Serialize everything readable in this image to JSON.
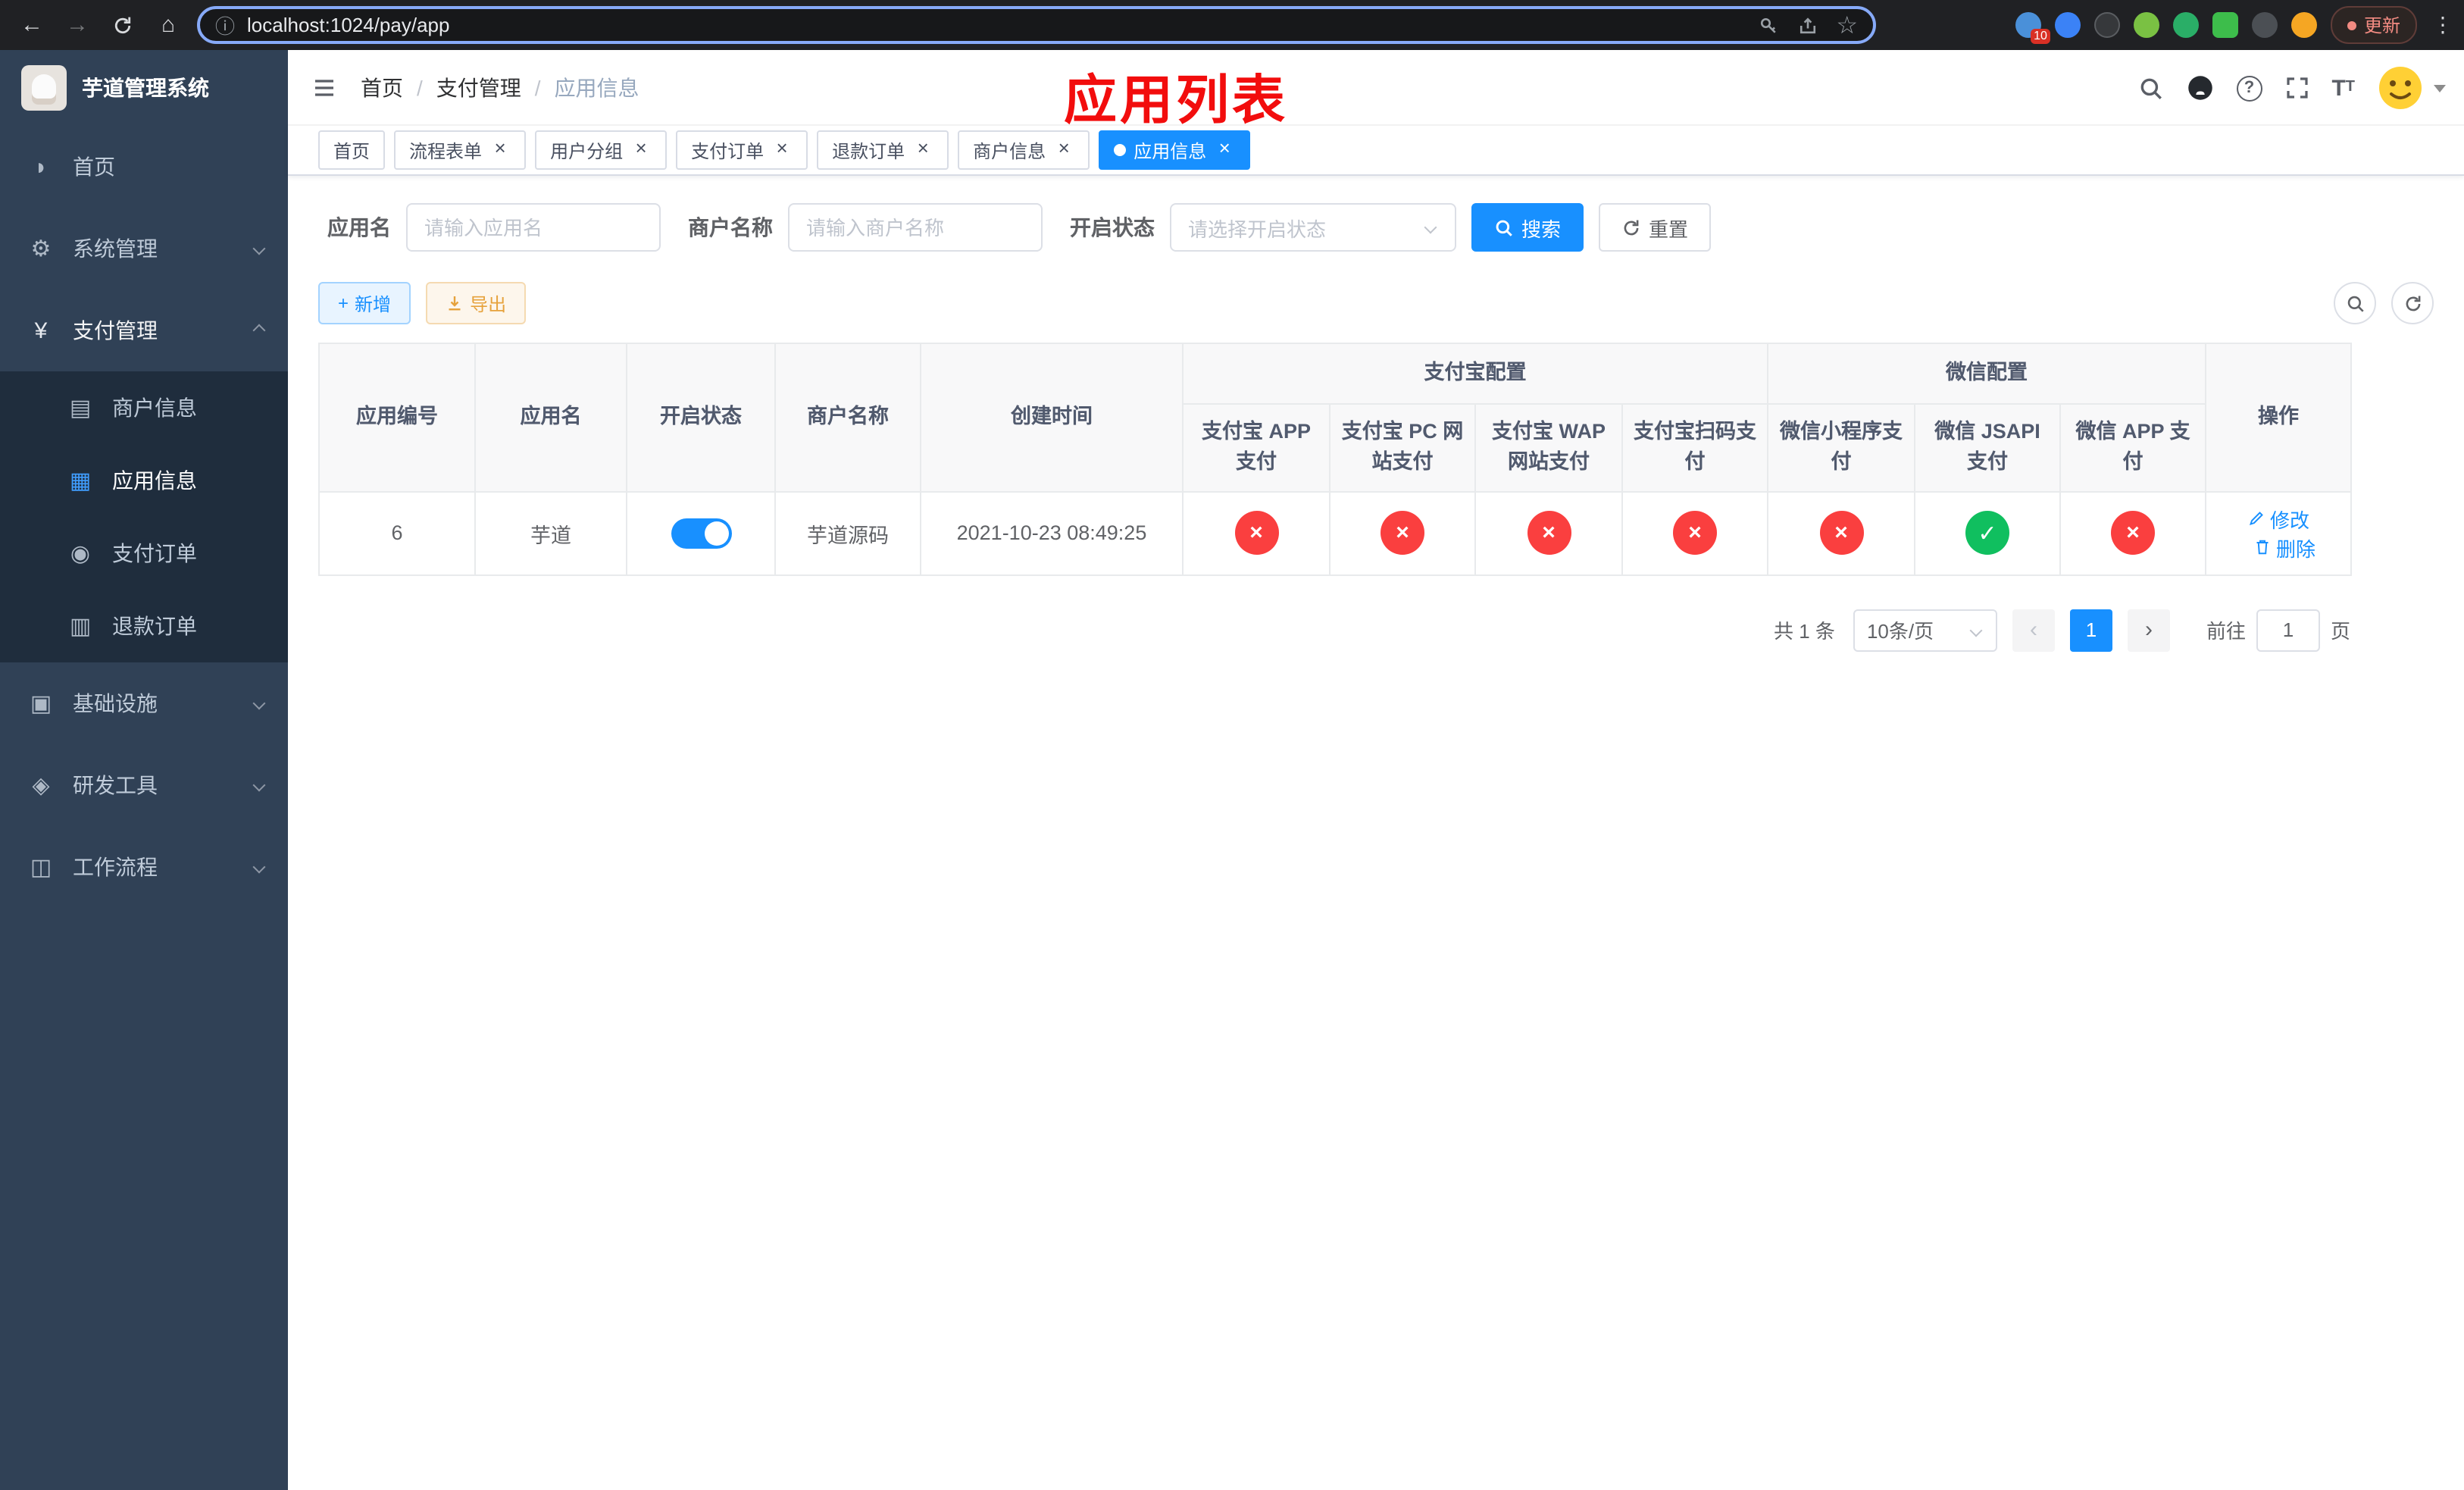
{
  "browser": {
    "url": "localhost:1024/pay/app",
    "update_label": "更新",
    "extension_badge": "10"
  },
  "app_title": "芋道管理系统",
  "sidebar": {
    "items": [
      {
        "label": "首页",
        "icon": "dashboard-icon"
      },
      {
        "label": "系统管理",
        "icon": "gear-icon"
      },
      {
        "label": "支付管理",
        "icon": "yuan-icon"
      },
      {
        "label": "商户信息",
        "icon": "card-icon"
      },
      {
        "label": "应用信息",
        "icon": "grid-icon"
      },
      {
        "label": "支付订单",
        "icon": "order-icon"
      },
      {
        "label": "退款订单",
        "icon": "refund-icon"
      },
      {
        "label": "基础设施",
        "icon": "infra-icon"
      },
      {
        "label": "研发工具",
        "icon": "devtool-icon"
      },
      {
        "label": "工作流程",
        "icon": "workflow-icon"
      }
    ]
  },
  "header": {
    "breadcrumb": {
      "home": "首页",
      "section": "支付管理",
      "page": "应用信息"
    },
    "annotation": "应用列表"
  },
  "tabs": [
    {
      "label": "首页"
    },
    {
      "label": "流程表单"
    },
    {
      "label": "用户分组"
    },
    {
      "label": "支付订单"
    },
    {
      "label": "退款订单"
    },
    {
      "label": "商户信息"
    },
    {
      "label": "应用信息"
    }
  ],
  "filters": {
    "app_name": {
      "label": "应用名",
      "placeholder": "请输入应用名"
    },
    "merchant_name": {
      "label": "商户名称",
      "placeholder": "请输入商户名称"
    },
    "status": {
      "label": "开启状态",
      "placeholder": "请选择开启状态"
    },
    "search_label": "搜索",
    "reset_label": "重置"
  },
  "toolbar": {
    "add_label": "新增",
    "export_label": "导出"
  },
  "table": {
    "headers": {
      "app_id": "应用编号",
      "app_name": "应用名",
      "status": "开启状态",
      "merchant": "商户名称",
      "create_time": "创建时间",
      "alipay_group": "支付宝配置",
      "wechat_group": "微信配置",
      "alipay_app": "支付宝 APP 支付",
      "alipay_pc": "支付宝 PC 网站支付",
      "alipay_wap": "支付宝 WAP 网站支付",
      "alipay_scan": "支付宝扫码支付",
      "wechat_mini": "微信小程序支付",
      "wechat_jsapi": "微信 JSAPI 支付",
      "wechat_app": "微信 APP 支付",
      "actions": "操作"
    },
    "rows": [
      {
        "app_id": "6",
        "app_name": "芋道",
        "status_on": true,
        "merchant": "芋道源码",
        "create_time": "2021-10-23 08:49:25",
        "configs": {
          "alipay_app": false,
          "alipay_pc": false,
          "alipay_wap": false,
          "alipay_scan": false,
          "wechat_mini": false,
          "wechat_jsapi": true,
          "wechat_app": false
        },
        "edit_label": "修改",
        "delete_label": "删除"
      }
    ]
  },
  "pagination": {
    "total": "共 1 条",
    "page_size": "10条/页",
    "current_page": "1",
    "goto_label": "前往",
    "goto_value": "1",
    "page_unit": "页"
  },
  "colors": {
    "primary": "#1890ff",
    "danger": "#fa3f3f",
    "success": "#10bf5f",
    "warning": "#e6a23c",
    "sidebar_bg": "#304156",
    "submenu_bg": "#1f2d3d",
    "annotation_red": "#f20d0d"
  }
}
